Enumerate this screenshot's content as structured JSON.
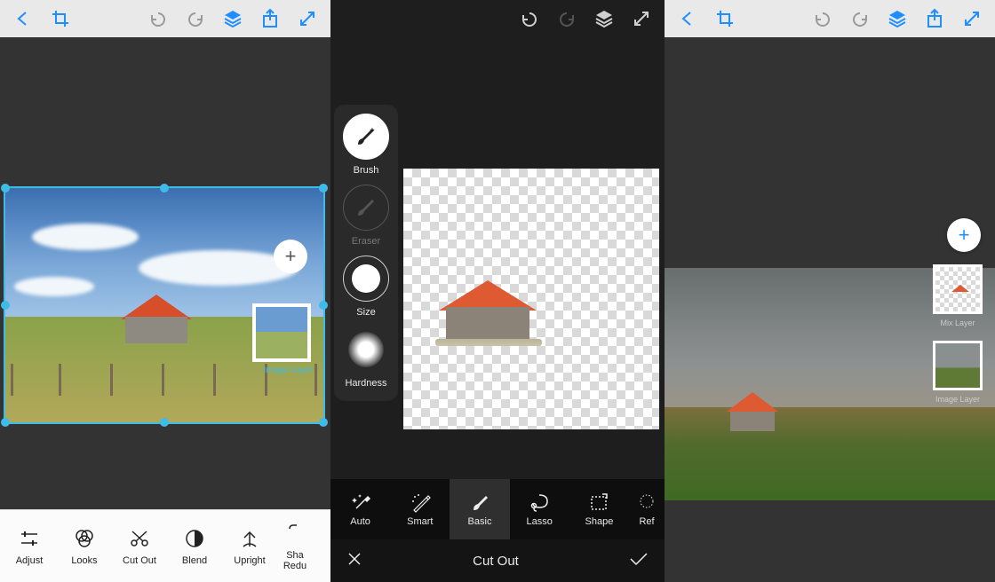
{
  "panes": {
    "left": {
      "toolbar": {
        "items": [
          "back",
          "crop",
          "undo",
          "redo",
          "layers",
          "share",
          "fullscreen"
        ]
      },
      "canvas": {
        "image_label": "Image Layer",
        "add_label": "+"
      },
      "bottom_tabs": [
        {
          "icon": "adjust",
          "label": "Adjust"
        },
        {
          "icon": "looks",
          "label": "Looks"
        },
        {
          "icon": "cutout",
          "label": "Cut Out"
        },
        {
          "icon": "blend",
          "label": "Blend"
        },
        {
          "icon": "upright",
          "label": "Upright"
        },
        {
          "icon": "shake",
          "label": "Sha Redu"
        }
      ]
    },
    "center": {
      "toolbar": {
        "items": [
          "undo",
          "redo",
          "layers",
          "fullscreen"
        ]
      },
      "tools": [
        {
          "icon": "brush",
          "label": "Brush",
          "state": "selected"
        },
        {
          "icon": "eraser",
          "label": "Eraser",
          "state": "dim"
        },
        {
          "icon": "size",
          "label": "Size",
          "state": "normal"
        },
        {
          "icon": "hardness",
          "label": "Hardness",
          "state": "normal"
        }
      ],
      "bottom_tabs": [
        {
          "icon": "auto",
          "label": "Auto"
        },
        {
          "icon": "smart",
          "label": "Smart"
        },
        {
          "icon": "basic",
          "label": "Basic",
          "active": true
        },
        {
          "icon": "lasso",
          "label": "Lasso"
        },
        {
          "icon": "shape",
          "label": "Shape"
        },
        {
          "icon": "refine",
          "label": "Ref"
        }
      ],
      "titlebar": {
        "cancel": "✕",
        "title": "Cut Out",
        "confirm": "✓"
      }
    },
    "right": {
      "toolbar": {
        "items": [
          "back",
          "crop",
          "undo",
          "redo",
          "layers",
          "share",
          "fullscreen"
        ]
      },
      "add_label": "+",
      "layers": [
        {
          "label": "Mix Layer"
        },
        {
          "label": "Image Layer"
        }
      ]
    }
  }
}
